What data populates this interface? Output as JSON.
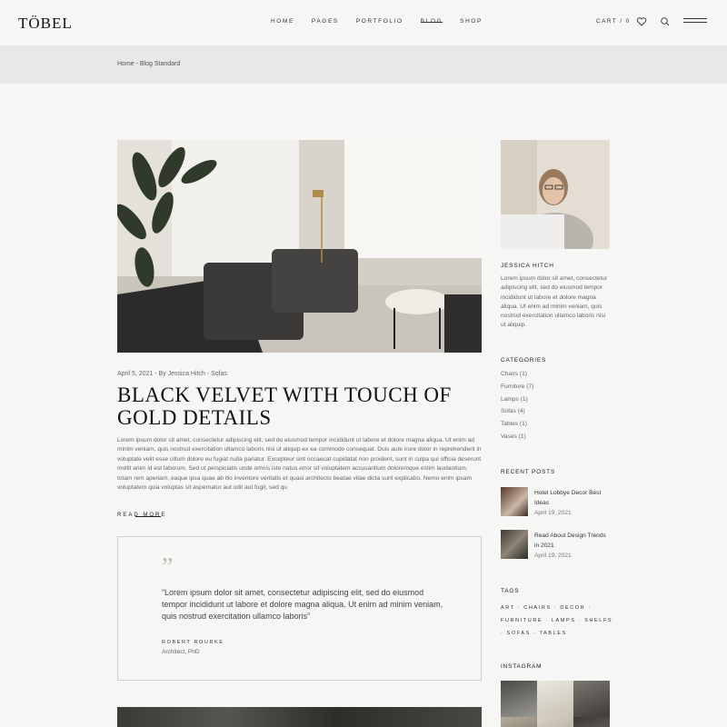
{
  "brand": {
    "logo": "TÖBEL"
  },
  "nav": {
    "items": [
      "HOME",
      "PAGES",
      "PORTFOLIO",
      "BLOG",
      "SHOP"
    ],
    "active": "BLOG"
  },
  "header": {
    "cart": "CART / 0"
  },
  "breadcrumb": {
    "text": "Home - Blog Standard"
  },
  "post": {
    "meta": "April 5, 2021 - By Jessica Hitch - Sofas",
    "title": "BLACK VELVET WITH TOUCH OF GOLD DETAILS",
    "excerpt": "Lorem ipsum dolor sit amet, consectetur adipiscing elit, sed do eiusmod tempor incididunt ut labore et dolore magna aliqua. Ut enim ad minim veniam, quis nostrud exercitation ullamco laboris nisi ut aliquip ex ea commodo consequat. Duis aute irure dolor in reprehenderit in voluptate velit esse cillum dolore eu fugiat nulla pariatur. Excepteur sint occaecat cupidatat non proident, sunt in culpa qui officia deserunt mollit anim id est laborum. Sed ut perspiciatis unde omnis iste natus error sit voluptatem accusantium doloremque estim laudantium, totam rem aperiam, eaque ipsa quae ab illo inventore veritatis et quasi architecto beatae vitae dicta sunt explicabo. Nemo enim ipsam voluptatem quia voluptas sit aspernatur aut odit aut fugit, sed qu",
    "read_more": "READ MORE"
  },
  "quote": {
    "mark": "”",
    "text": "“Lorem ipsum dolor sit amet, consectetur adipiscing elit, sed do eiusmod tempor incididunt ut labore et dolore magna aliqua. Ut enim ad minim veniam, quis nostrud exercitation ullamco laboris”",
    "author": "ROBERT ROURKE",
    "role": "Architect, PhD"
  },
  "sidebar": {
    "author_name": "JESSICA HITCH",
    "author_bio": "Lorem ipsum dolor sit amet, consectetur adipiscing elit, sed do eiusmod tempor incididunt ut labore et dolore magna aliqua. Ut enim ad minim veniam, quis nostrud exercitation ullamco laboris nisi ut aliquip.",
    "categories_title": "CATEGORIES",
    "categories": [
      "Chairs (1)",
      "Furniture (7)",
      "Lamps (1)",
      "Sofas (4)",
      "Tables (1)",
      "Vases (1)"
    ],
    "recent_title": "RECENT POSTS",
    "recent": [
      {
        "title": "Hotel Lobbye Decor Best Ideas",
        "date": "April 19, 2021"
      },
      {
        "title": "Read About Design Trends in 2021",
        "date": "April 19, 2021"
      }
    ],
    "tags_title": "TAGS",
    "tags": "ART · CHAIRS · DECOR · FURNITURE · LAMPS · SHELFS · SOFAS · TABLES",
    "instagram_title": "INSTAGRAM"
  },
  "colors": {
    "background": "#f6f6f5",
    "breadcrumb_bar": "#e8e8e7",
    "quote_mark": "#c5b9a8"
  }
}
